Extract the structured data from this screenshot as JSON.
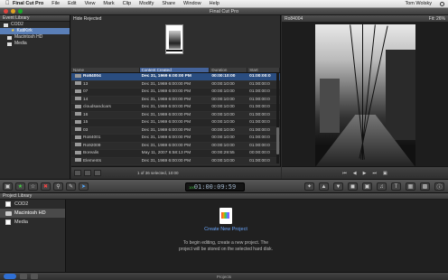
{
  "menubar": {
    "app": "Final Cut Pro",
    "items": [
      "File",
      "Edit",
      "View",
      "Mark",
      "Clip",
      "Modify",
      "Share",
      "Window",
      "Help"
    ],
    "user": "Tom Wolsky"
  },
  "window": {
    "title": "Final Cut Pro"
  },
  "event_library": {
    "header": "Event Library",
    "items": [
      {
        "label": "COD2"
      },
      {
        "label": "KatiKirk"
      },
      {
        "label": "Macintosh HD"
      },
      {
        "label": "Media"
      }
    ]
  },
  "browser": {
    "filter": "Hide Rejected",
    "columns": [
      "Name",
      "Content Created",
      "Duration",
      "Start"
    ],
    "rows": [
      {
        "name": "Ro84004",
        "date": "Dec 31, 1969 6:00:00 PM",
        "duration": "00:00:10:00",
        "start": "01:00:00:0"
      },
      {
        "name": "13",
        "date": "Dec 31, 1969 6:00:00 PM",
        "duration": "00:00:10:00",
        "start": "01:00:00:0"
      },
      {
        "name": "07",
        "date": "Dec 31, 1969 6:00:00 PM",
        "duration": "00:00:10:00",
        "start": "01:00:00:0"
      },
      {
        "name": "14",
        "date": "Dec 31, 1969 6:00:00 PM",
        "duration": "00:00:10:00",
        "start": "01:00:00:0"
      },
      {
        "name": "cloudsandcars",
        "date": "Dec 31, 1969 6:00:00 PM",
        "duration": "00:00:10:00",
        "start": "01:00:00:0"
      },
      {
        "name": "16",
        "date": "Dec 31, 1969 6:00:00 PM",
        "duration": "00:00:10:00",
        "start": "01:00:00:0"
      },
      {
        "name": "15",
        "date": "Dec 31, 1969 6:00:00 PM",
        "duration": "00:00:10:00",
        "start": "01:00:00:0"
      },
      {
        "name": "03",
        "date": "Dec 31, 1969 6:00:00 PM",
        "duration": "00:00:10:00",
        "start": "01:00:00:0"
      },
      {
        "name": "Ro84001",
        "date": "Dec 31, 1969 6:00:00 PM",
        "duration": "00:00:10:00",
        "start": "01:00:00:0"
      },
      {
        "name": "Ro92009",
        "date": "Dec 31, 1969 6:00:00 PM",
        "duration": "00:00:10:00",
        "start": "01:00:00:0"
      },
      {
        "name": "Borealis",
        "date": "May 11, 2007 6:58:13 PM",
        "duration": "00:00:29:55",
        "start": "00:00:00:0"
      },
      {
        "name": "Elements",
        "date": "Dec 31, 1969 6:00:00 PM",
        "duration": "00:00:10:00",
        "start": "01:00:00:0"
      }
    ],
    "footer": "1 of 36 selected, 10:00"
  },
  "viewer": {
    "clip": "Ro84004",
    "zoom": "Fit: 26%"
  },
  "toolbar": {
    "timecode": "01:00:09:59",
    "timecode_label": "100"
  },
  "project_library": {
    "header": "Project Library",
    "items": [
      {
        "label": "COD2"
      },
      {
        "label": "Macintosh HD"
      },
      {
        "label": "Media"
      }
    ],
    "create_label": "Create New Project",
    "message": "To begin editing, create a new project. The project will be stored on the selected hard disk.",
    "footer": "Projects"
  }
}
